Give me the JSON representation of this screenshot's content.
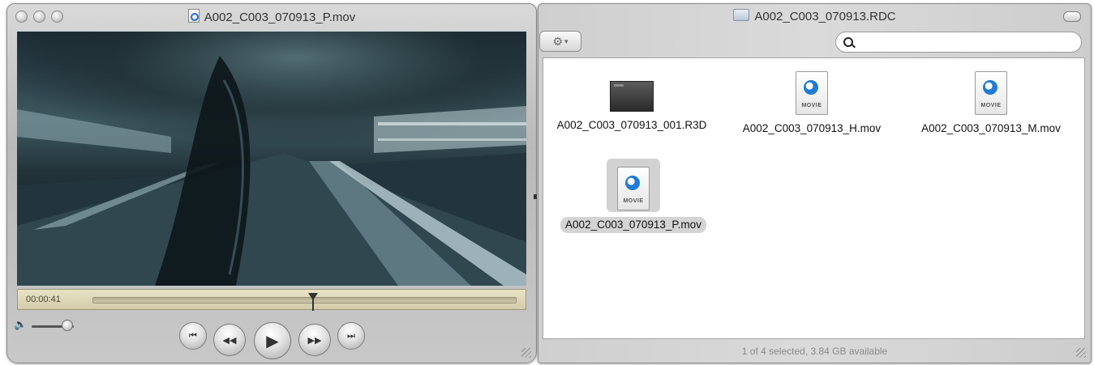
{
  "player": {
    "title": "A002_C003_070913_P.mov",
    "timecode": "00:00:41",
    "playback_progress": 0.52,
    "volume_level": 0.85,
    "buttons": {
      "go_to_start": "⏮",
      "rewind": "◀◀",
      "play": "▶",
      "fast_forward": "▶▶",
      "go_to_end": "⏭",
      "volume_icon": "🔈"
    }
  },
  "finder": {
    "title": "A002_C003_070913.RDC",
    "action_button_icon": "⚙",
    "action_button_caret": "▾",
    "search": {
      "value": "",
      "placeholder": ""
    },
    "files": [
      {
        "name": "A002_C003_070913_001.R3D",
        "icon": "r3d-thumbnail-icon",
        "selected": false
      },
      {
        "name": "A002_C003_070913_H.mov",
        "icon": "quicktime-movie-icon",
        "selected": false
      },
      {
        "name": "A002_C003_070913_M.mov",
        "icon": "quicktime-movie-icon",
        "selected": false
      },
      {
        "name": "A002_C003_070913_P.mov",
        "icon": "quicktime-movie-icon",
        "selected": true
      }
    ],
    "movie_tag": "MOVIE",
    "status": "1 of 4 selected, 3.84 GB available"
  },
  "colors": {
    "timebar": "#ded8b8",
    "selection": "#d4d4d4",
    "quicktime_blue": "#1f7ad8"
  }
}
